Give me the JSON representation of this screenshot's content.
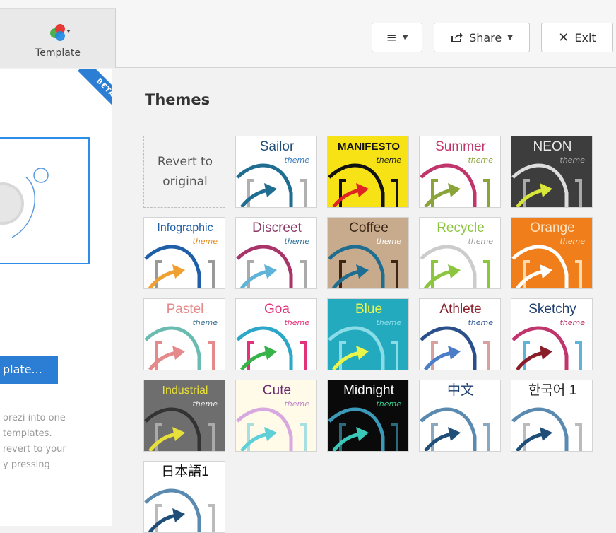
{
  "toolbar": {
    "template_label": "Template",
    "share_label": "Share",
    "exit_label": "Exit",
    "menu_icon": "hamburger-icon"
  },
  "sidebar": {
    "beta_label": "BETA",
    "choose_button": "plate...",
    "description_lines": [
      "orezi into one",
      "templates.",
      "revert to your",
      "y pressing"
    ]
  },
  "themes": {
    "heading": "Themes",
    "revert_line1": "Revert to",
    "revert_line2": "original",
    "items": [
      {
        "name": "Sailor",
        "sub": "theme",
        "bg": "#ffffff",
        "fg": "#1f4e79",
        "sub_color": "#3a7dbf",
        "arc": "#1f6e91",
        "arrow": "#1f6e91",
        "bracket": "#b0b0b0"
      },
      {
        "name": "MANIFESTO",
        "sub": "theme",
        "bg": "#f7e315",
        "fg": "#111111",
        "sub_color": "#222222",
        "arc": "#111111",
        "arrow": "#e02424",
        "bracket": "#111111"
      },
      {
        "name": "Summer",
        "sub": "theme",
        "bg": "#ffffff",
        "fg": "#c0356b",
        "sub_color": "#8aa43a",
        "arc": "#c0356b",
        "arrow": "#8aa43a",
        "bracket": "#8aa43a"
      },
      {
        "name": "NEON",
        "sub": "theme",
        "bg": "#3d3d3d",
        "fg": "#e8e8e8",
        "sub_color": "#aaaaaa",
        "arc": "#dddddd",
        "arrow": "#d8e63a",
        "bracket": "#aaaaaa"
      },
      {
        "name": "Infographic",
        "sub": "theme",
        "bg": "#ffffff",
        "fg": "#1f5fa8",
        "sub_color": "#e08a1e",
        "arc": "#1f5fa8",
        "arrow": "#f0a030",
        "bracket": "#999999"
      },
      {
        "name": "Discreet",
        "sub": "theme",
        "bg": "#ffffff",
        "fg": "#8a3a68",
        "sub_color": "#2c6f9a",
        "arc": "#a8346a",
        "arrow": "#5fb3d8",
        "bracket": "#aaaaaa"
      },
      {
        "name": "Coffee",
        "sub": "theme",
        "bg": "#c7ab8c",
        "fg": "#3b2515",
        "sub_color": "#ffffff",
        "arc": "#1f6e91",
        "arrow": "#1f6e91",
        "bracket": "#3b2515"
      },
      {
        "name": "Recycle",
        "sub": "theme",
        "bg": "#ffffff",
        "fg": "#8cc63f",
        "sub_color": "#999999",
        "arc": "#cccccc",
        "arrow": "#8cc63f",
        "bracket": "#8cc63f"
      },
      {
        "name": "Orange",
        "sub": "theme",
        "bg": "#f07e1a",
        "fg": "#ffe2c2",
        "sub_color": "#ffe2c2",
        "arc": "#ffffff",
        "arrow": "#ffffff",
        "bracket": "#ffd9b0"
      },
      {
        "name": "Pastel",
        "sub": "theme",
        "bg": "#ffffff",
        "fg": "#e58a8a",
        "sub_color": "#3a6f8f",
        "arc": "#6bbcb0",
        "arrow": "#e58a8a",
        "bracket": "#e58a8a"
      },
      {
        "name": "Goa",
        "sub": "theme",
        "bg": "#ffffff",
        "fg": "#e2337a",
        "sub_color": "#e2337a",
        "arc": "#2aa7c9",
        "arrow": "#37b34a",
        "bracket": "#e2337a"
      },
      {
        "name": "Blue",
        "sub": "theme",
        "bg": "#23aabf",
        "fg": "#e8f54a",
        "sub_color": "#8adce6",
        "arc": "#8adce6",
        "arrow": "#e8f54a",
        "bracket": "#8adce6"
      },
      {
        "name": "Athlete",
        "sub": "theme",
        "bg": "#ffffff",
        "fg": "#8a1e28",
        "sub_color": "#3a5f9a",
        "arc": "#2a4f8a",
        "arrow": "#4a7ec9",
        "bracket": "#d9a0a0"
      },
      {
        "name": "Sketchy",
        "sub": "theme",
        "bg": "#ffffff",
        "fg": "#1f3f6f",
        "sub_color": "#c0356b",
        "arc": "#c0356b",
        "arrow": "#8a1e28",
        "bracket": "#5fb3d8"
      },
      {
        "name": "Industrial",
        "sub": "theme",
        "bg": "#6e6e6e",
        "fg": "#e8e03a",
        "sub_color": "#eeeeee",
        "arc": "#333333",
        "arrow": "#e8e03a",
        "bracket": "#aaaaaa"
      },
      {
        "name": "Cute",
        "sub": "theme",
        "bg": "#fffbe8",
        "fg": "#6a2a6f",
        "sub_color": "#c08ac9",
        "arc": "#d8a8e0",
        "arrow": "#5fd0d8",
        "bracket": "#a8e0e0"
      },
      {
        "name": "Midnight",
        "sub": "theme",
        "bg": "#0a0a0a",
        "fg": "#ffffff",
        "sub_color": "#3ac98a",
        "arc": "#3a9ab8",
        "arrow": "#3ac9b8",
        "bracket": "#2a6a7a"
      },
      {
        "name": "中文",
        "sub": "",
        "bg": "#ffffff",
        "fg": "#1f3f6f",
        "sub_color": "#333333",
        "arc": "#5a8ab0",
        "arrow": "#1f4e79",
        "bracket": "#8aa8c0"
      },
      {
        "name": "한국어 1",
        "sub": "",
        "bg": "#ffffff",
        "fg": "#222222",
        "sub_color": "#333333",
        "arc": "#5a8ab0",
        "arrow": "#1f4e79",
        "bracket": "#bbbbbb"
      },
      {
        "name": "日本語1",
        "sub": "",
        "bg": "#ffffff",
        "fg": "#111111",
        "sub_color": "#333333",
        "arc": "#5a8ab0",
        "arrow": "#1f4e79",
        "bracket": "#bbbbbb"
      }
    ]
  }
}
